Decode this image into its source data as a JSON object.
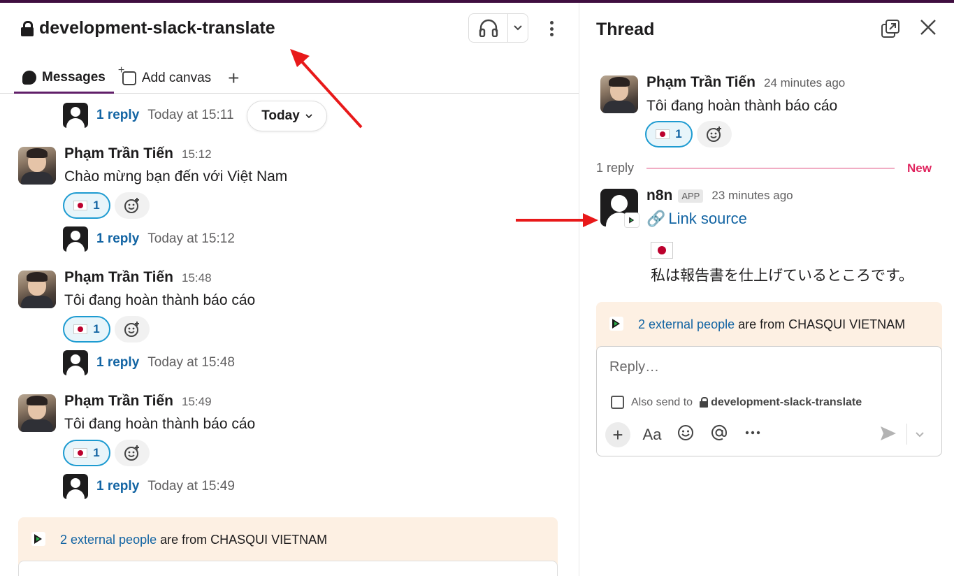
{
  "channel": {
    "name": "development-slack-translate",
    "tabs": {
      "messages": "Messages",
      "add_canvas": "Add canvas",
      "add": "+"
    }
  },
  "today_pill": "Today",
  "messages": [
    {
      "reply_count": "1 reply",
      "reply_time": "Today at 15:11"
    },
    {
      "author": "Phạm Trần Tiến",
      "time": "15:12",
      "text": "Chào mừng bạn đến với Việt Nam",
      "reaction_count": "1",
      "reply_count": "1 reply",
      "reply_time": "Today at 15:12"
    },
    {
      "author": "Phạm Trần Tiến",
      "time": "15:48",
      "text": "Tôi đang hoàn thành báo cáo",
      "reaction_count": "1",
      "reply_count": "1 reply",
      "reply_time": "Today at 15:48"
    },
    {
      "author": "Phạm Trần Tiến",
      "time": "15:49",
      "text": "Tôi đang hoàn thành báo cáo",
      "reaction_count": "1",
      "reply_count": "1 reply",
      "reply_time": "Today at 15:49"
    }
  ],
  "external_banner": {
    "link": "2 external people",
    "rest": " are from CHASQUI VIETNAM"
  },
  "thread": {
    "title": "Thread",
    "parent": {
      "author": "Phạm Trần Tiến",
      "time": "24 minutes ago",
      "text": "Tôi đang hoàn thành báo cáo",
      "reaction_count": "1"
    },
    "reply_count": "1 reply",
    "new_label": "New",
    "reply": {
      "author": "n8n",
      "badge": "APP",
      "time": "23 minutes ago",
      "link_emoji": "🔗",
      "link_text": "Link source",
      "translation": "私は報告書を仕上げているところです。"
    },
    "composer": {
      "placeholder": "Reply…",
      "also_send": "Also send to",
      "channel": "development-slack-translate",
      "format_label": "Aa"
    }
  },
  "colors": {
    "accent": "#611f69",
    "link": "#1264a3",
    "banner": "#fdf0e3",
    "new": "#e0245e",
    "annotation": "#e8191a"
  }
}
